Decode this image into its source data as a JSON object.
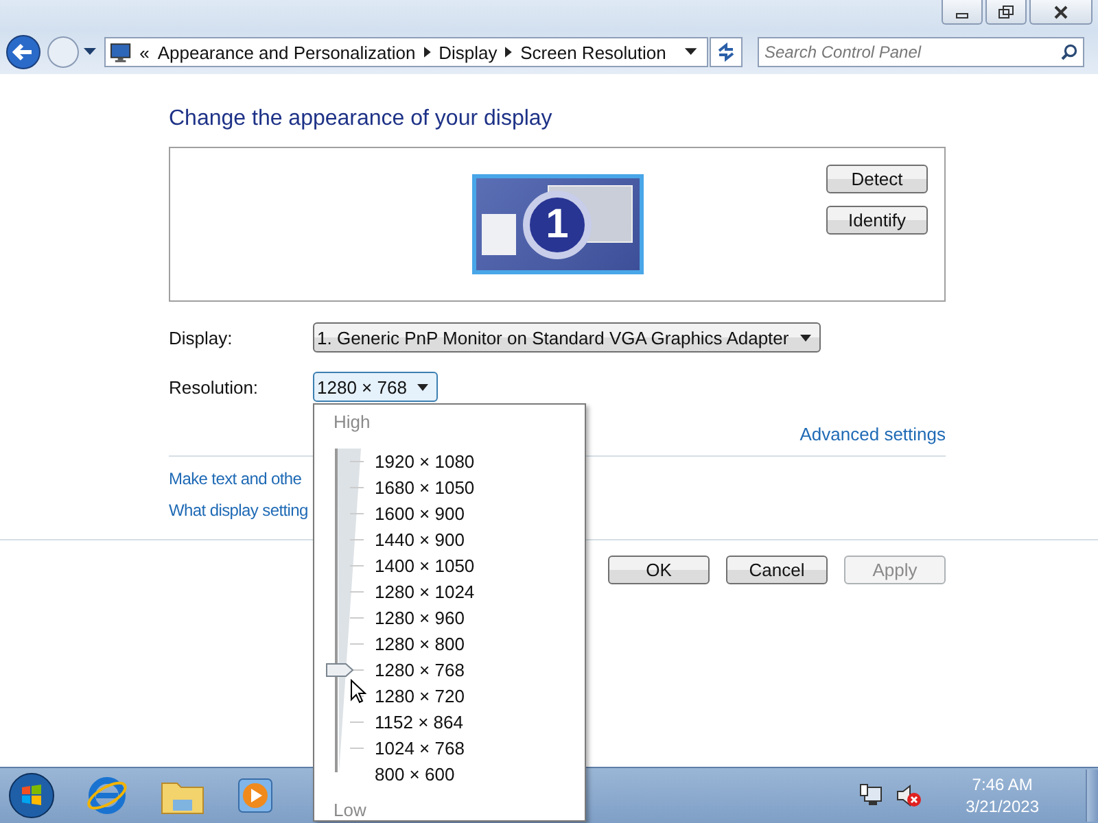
{
  "address_bar": {
    "overflow_mark": "«",
    "breadcrumbs": [
      "Appearance and Personalization",
      "Display",
      "Screen Resolution"
    ]
  },
  "search": {
    "placeholder": "Search Control Panel"
  },
  "heading": "Change the appearance of your display",
  "preview": {
    "monitor_number": "1",
    "buttons": [
      "Detect",
      "Identify"
    ]
  },
  "settings": [
    {
      "label": "Display:",
      "value": "1. Generic PnP Monitor on Standard VGA Graphics Adapter",
      "expanded": false
    },
    {
      "label": "Resolution:",
      "value": "1280 × 768",
      "expanded": true
    }
  ],
  "advanced_link": "Advanced settings",
  "links": [
    "Make text and othe",
    "What display setting"
  ],
  "buttons": [
    {
      "label": "OK",
      "disabled": false
    },
    {
      "label": "Cancel",
      "disabled": false
    },
    {
      "label": "Apply",
      "disabled": true
    }
  ],
  "resolution_popup": {
    "high_label": "High",
    "low_label": "Low",
    "level": 0.333,
    "options": [
      "1920 × 1080",
      "1680 × 1050",
      "1600 × 900",
      "1440 × 900",
      "1400 × 1050",
      "1280 × 1024",
      "1280 × 960",
      "1280 × 800",
      "1280 × 768",
      "1280 × 720",
      "1152 × 864",
      "1024 × 768",
      "800 × 600"
    ]
  },
  "clock": {
    "time": "7:46 AM",
    "date": "3/21/2023"
  }
}
